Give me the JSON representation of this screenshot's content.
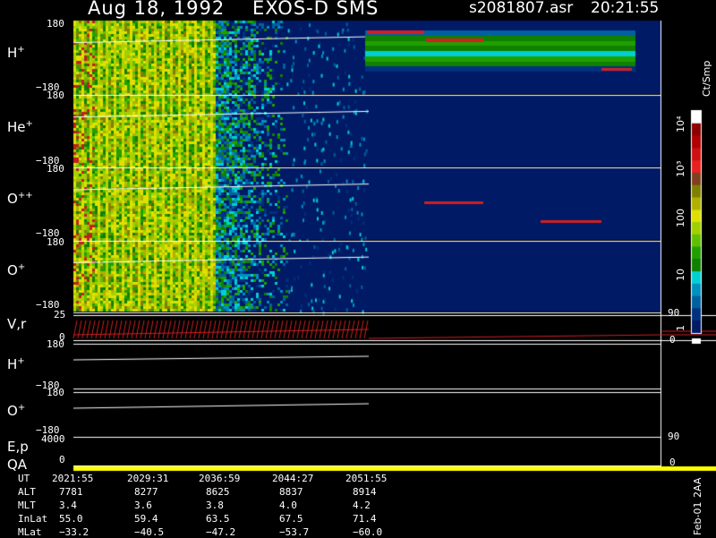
{
  "header": {
    "date": "Aug 18, 1992",
    "instrument": "EXOS-D SMS",
    "filename": "s2081807.asr",
    "time": "20:21:55"
  },
  "panels": {
    "h": {
      "label": "H",
      "sup": "+",
      "ymax": "180",
      "ymin": "−180"
    },
    "he": {
      "label": "He",
      "sup": "+",
      "ymax": "180",
      "ymin": "−180"
    },
    "o2": {
      "label": "O",
      "sup": "++",
      "ymax": "180",
      "ymin": "−180"
    },
    "o": {
      "label": "O",
      "sup": "+",
      "ymax": "180",
      "ymin": "−180"
    },
    "vr": {
      "label": "V,r",
      "ymax": "25",
      "ymin": "0",
      "right_top": "90",
      "right_bottom": "0"
    },
    "h2": {
      "label": "H",
      "sup": "+",
      "ymax": "180",
      "ymin": "−180"
    },
    "o3": {
      "label": "O",
      "sup": "+",
      "ymax": "180",
      "ymin": "−180"
    },
    "ep": {
      "label1": "E,p",
      "label2": "QA",
      "ymax": "4000",
      "ymin": "0",
      "right_top": "90",
      "right_bottom": "0"
    }
  },
  "colorbar": {
    "unit": "Ct/Smp",
    "ticks": [
      "10⁴",
      "10³",
      "100",
      "10",
      "1"
    ],
    "colors": [
      "#ffffff",
      "#8b0000",
      "#b00000",
      "#d01010",
      "#e82020",
      "#804020",
      "#808000",
      "#b0b000",
      "#e0e000",
      "#a0d000",
      "#60c000",
      "#20a000",
      "#108000",
      "#00d0d0",
      "#0090c0",
      "#0060a0",
      "#003080",
      "#001a66"
    ]
  },
  "footer": {
    "rows": [
      {
        "label": "UT",
        "values": [
          "2021:55",
          "2029:31",
          "2036:59",
          "2044:27",
          "2051:55"
        ]
      },
      {
        "label": "ALT",
        "values": [
          "7781",
          "8277",
          "8625",
          "8837",
          "8914"
        ]
      },
      {
        "label": "MLT",
        "values": [
          "3.4",
          "3.6",
          "3.8",
          "4.0",
          "4.2"
        ]
      },
      {
        "label": "InLat",
        "values": [
          "55.0",
          "59.4",
          "63.5",
          "67.5",
          "71.4"
        ]
      },
      {
        "label": "MLat",
        "values": [
          "−33.2",
          "−40.5",
          "−47.2",
          "−53.7",
          "−60.0"
        ]
      }
    ],
    "stamp1": "Feb-01",
    "stamp2": "2AA"
  },
  "chart_data": {
    "type": "heatmap",
    "title": "Aug 18, 1992   EXOS-D SMS",
    "x_ticks_ut": [
      "2021:55",
      "2029:31",
      "2036:59",
      "2044:27",
      "2051:55"
    ],
    "species_panels": [
      "H+",
      "He+",
      "O++",
      "O+"
    ],
    "pitch_angle_range": [
      -180,
      180
    ],
    "colorbar_scale": "log",
    "colorbar_range": [
      1,
      10000
    ],
    "colorbar_unit": "Ct/Smp"
  }
}
